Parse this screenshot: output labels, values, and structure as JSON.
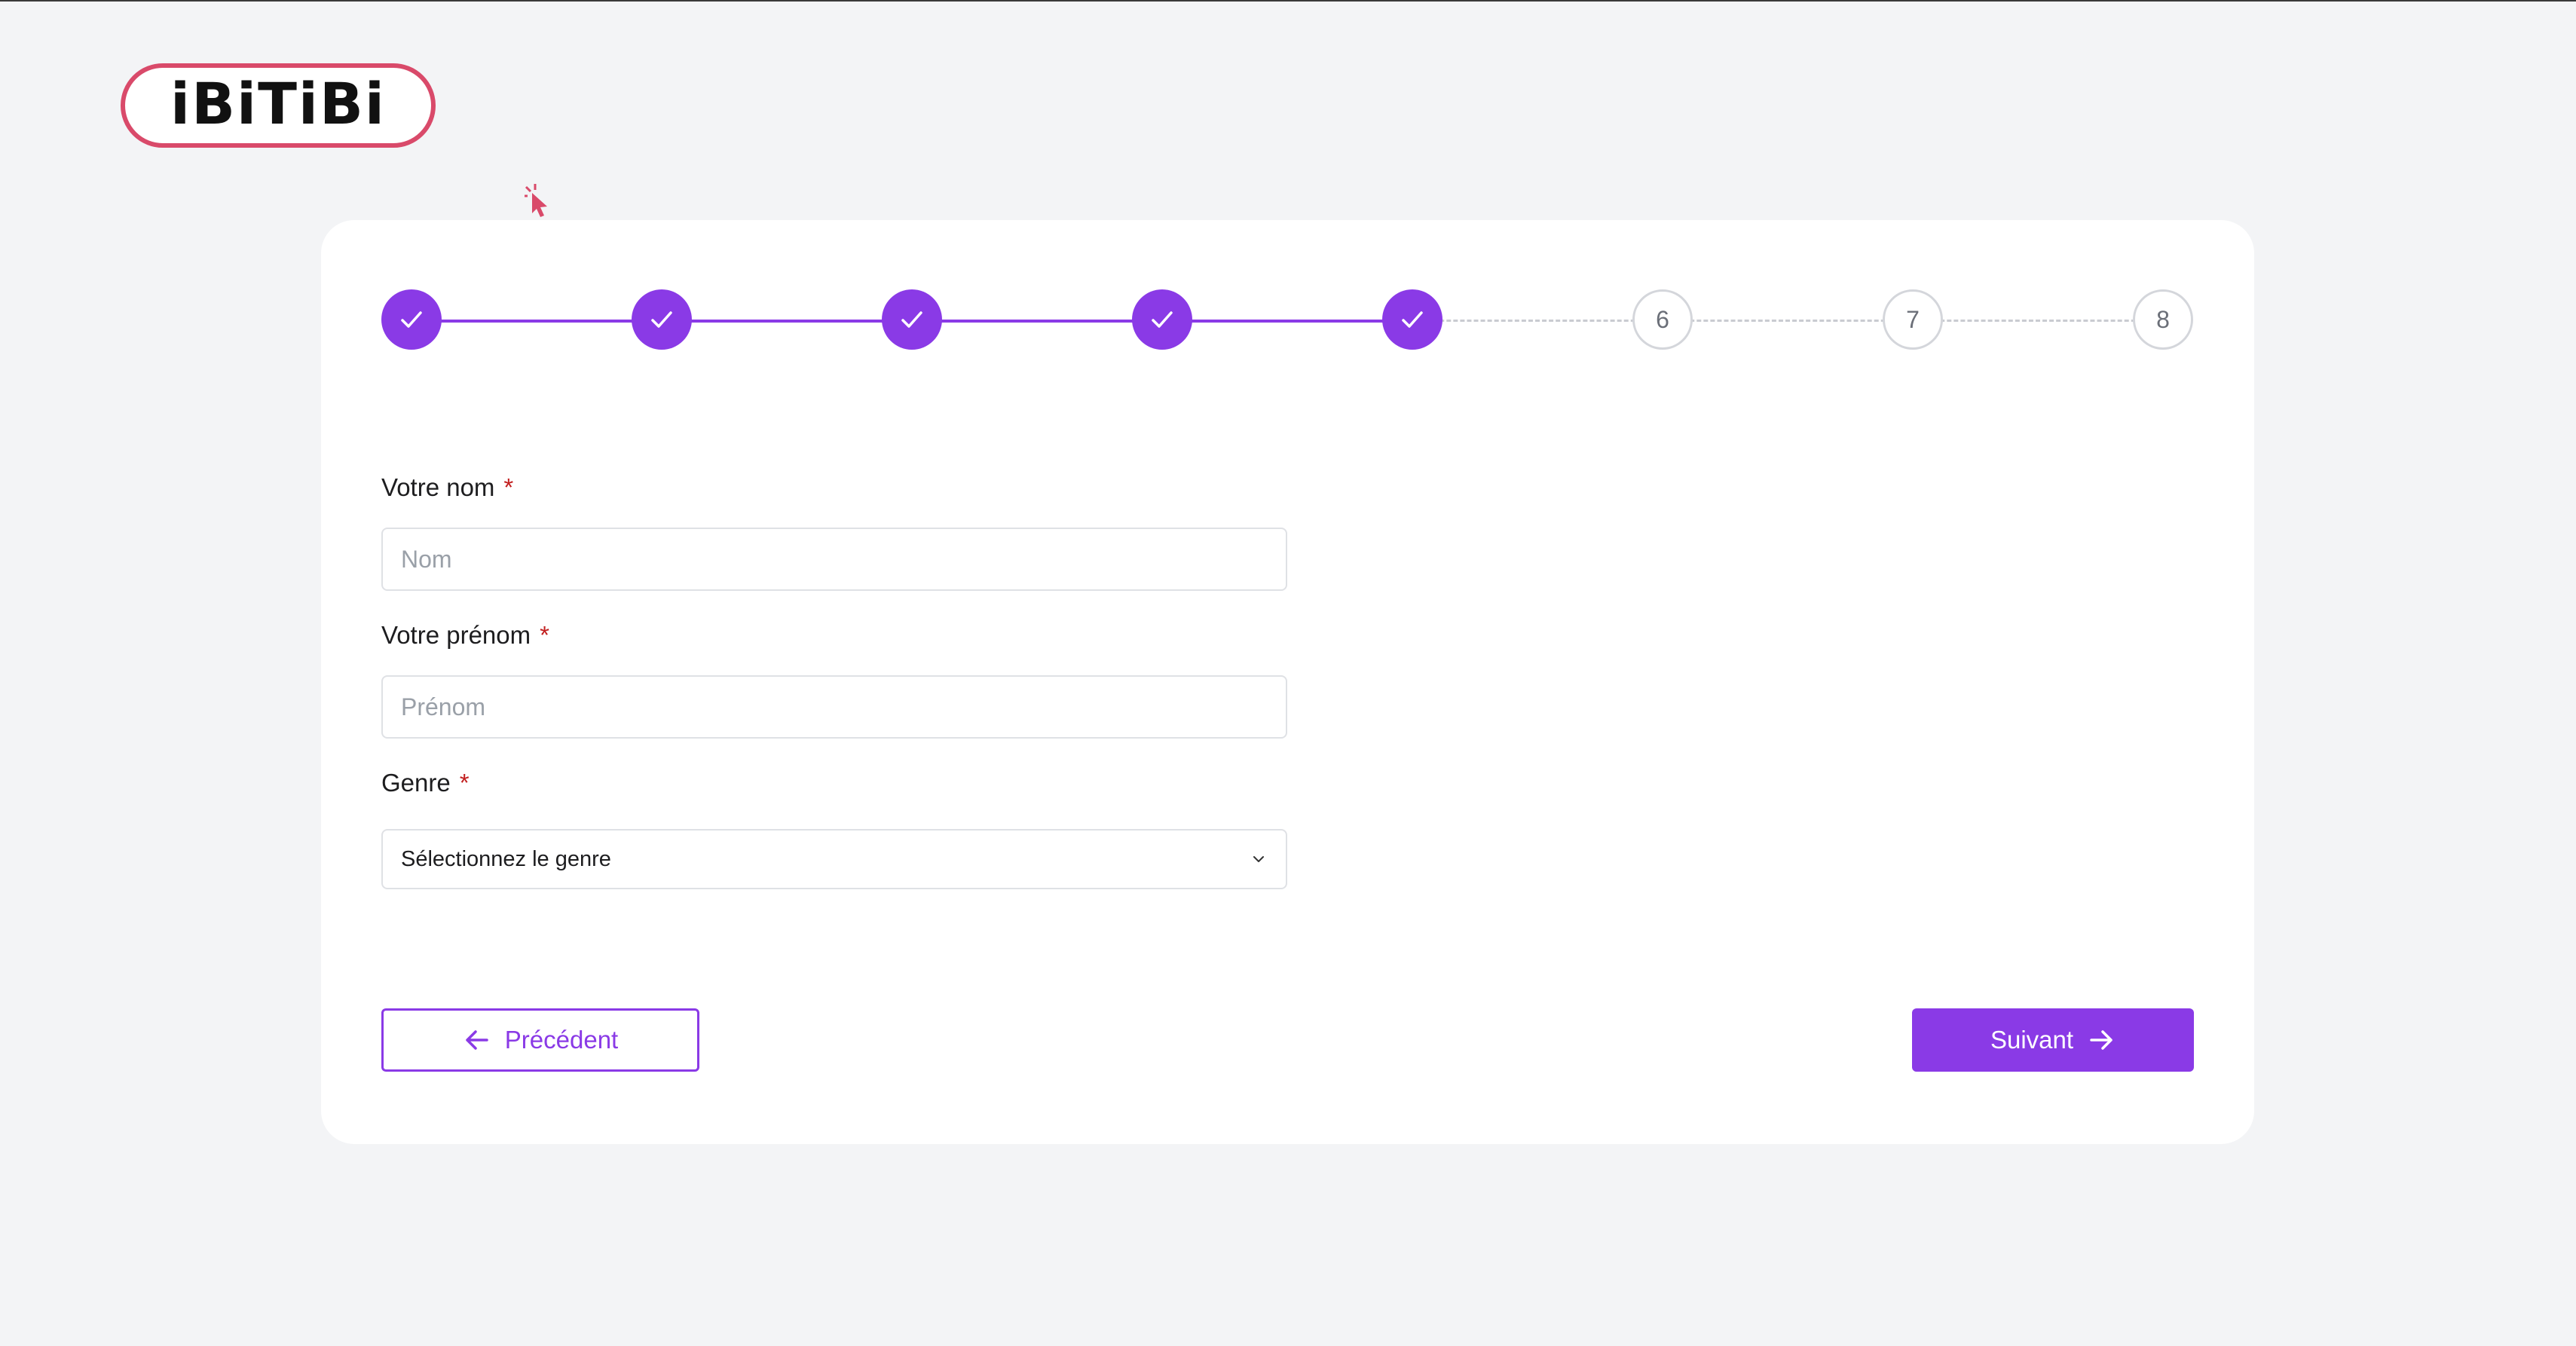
{
  "brand": {
    "logo_text": "iBiTiBi",
    "accent_color": "#8a3ae6",
    "logo_border_color": "#d94a6a"
  },
  "stepper": {
    "current_step": 6,
    "total_steps": 8,
    "steps": [
      {
        "label": "1",
        "status": "done"
      },
      {
        "label": "2",
        "status": "done"
      },
      {
        "label": "3",
        "status": "done"
      },
      {
        "label": "4",
        "status": "done"
      },
      {
        "label": "5",
        "status": "done"
      },
      {
        "label": "6",
        "status": "todo"
      },
      {
        "label": "7",
        "status": "todo"
      },
      {
        "label": "8",
        "status": "todo"
      }
    ]
  },
  "form": {
    "required_marker": "*",
    "last_name": {
      "label": "Votre nom",
      "placeholder": "Nom",
      "value": ""
    },
    "first_name": {
      "label": "Votre prénom",
      "placeholder": "Prénom",
      "value": ""
    },
    "gender": {
      "label": "Genre",
      "selected": "Sélectionnez le genre"
    }
  },
  "actions": {
    "previous_label": "Précédent",
    "next_label": "Suivant"
  },
  "icons": {
    "done_step": "check-icon",
    "previous": "arrow-left-icon",
    "next": "arrow-right-icon",
    "select": "chevron-down-icon"
  }
}
